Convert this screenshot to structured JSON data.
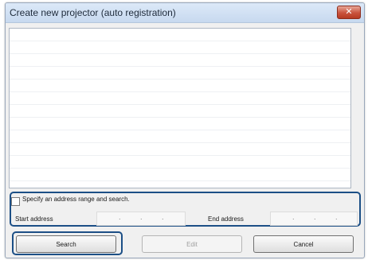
{
  "window": {
    "title": "Create new projector (auto registration)",
    "close_glyph": "✕"
  },
  "range": {
    "checkbox_label": "Specify an address range and search.",
    "checked": false,
    "start_label": "Start address",
    "end_label": "End address",
    "start_value": "",
    "end_value": ""
  },
  "buttons": {
    "search": "Search",
    "edit": "Edit",
    "cancel": "Cancel"
  },
  "colors": {
    "highlight_outline": "#1c4f86",
    "close_button": "#c9533d"
  },
  "icons": {
    "close": "close-icon"
  }
}
